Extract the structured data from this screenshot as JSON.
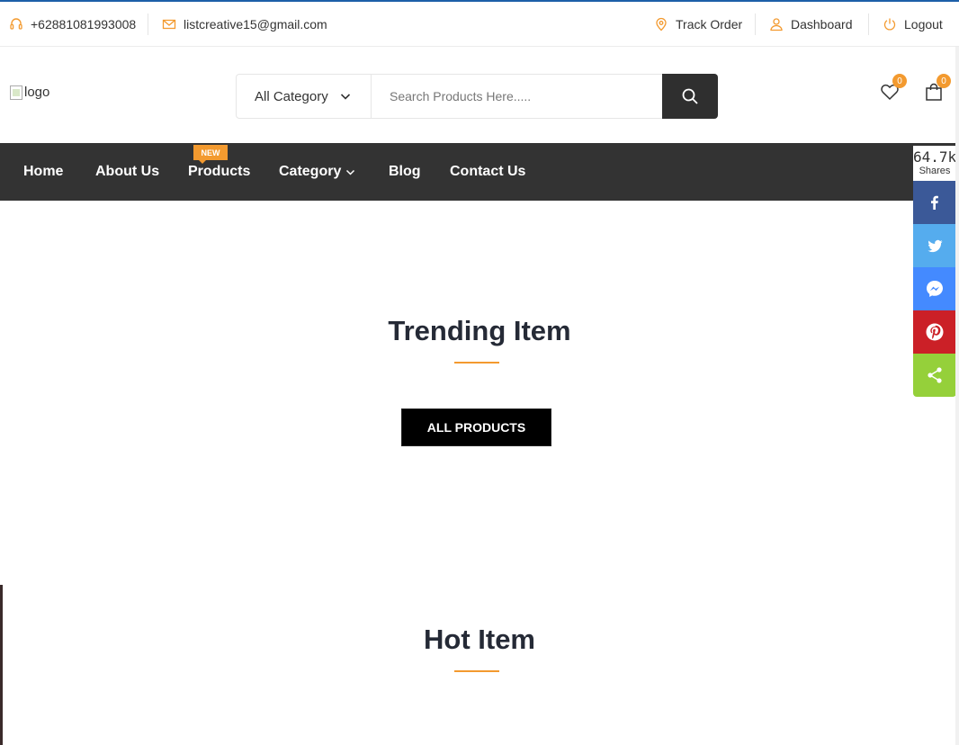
{
  "topbar": {
    "phone": "+62881081993008",
    "email": "listcreative15@gmail.com",
    "track_order": "Track Order",
    "dashboard": "Dashboard",
    "logout": "Logout"
  },
  "header": {
    "logo_alt": "logo",
    "category_label": "All Category",
    "search_placeholder": "Search Products Here.....",
    "wishlist_count": "0",
    "cart_count": "0"
  },
  "nav": {
    "items": [
      {
        "label": "Home"
      },
      {
        "label": "About Us"
      },
      {
        "label": "Products",
        "badge": "NEW"
      },
      {
        "label": "Category"
      },
      {
        "label": "Blog"
      },
      {
        "label": "Contact Us"
      }
    ]
  },
  "sections": {
    "trending_title": "Trending Item",
    "all_products_label": "ALL PRODUCTS",
    "hot_title": "Hot Item"
  },
  "share": {
    "count": "64.7k",
    "label": "Shares",
    "buttons": [
      {
        "name": "facebook",
        "color": "#3b5998"
      },
      {
        "name": "twitter",
        "color": "#55acee"
      },
      {
        "name": "messenger",
        "color": "#448aff"
      },
      {
        "name": "pinterest",
        "color": "#cb2027"
      },
      {
        "name": "share",
        "color": "#95d03a"
      }
    ]
  },
  "colors": {
    "accent": "#f39a2f",
    "nav_bg": "#333333",
    "title": "#252a36"
  }
}
